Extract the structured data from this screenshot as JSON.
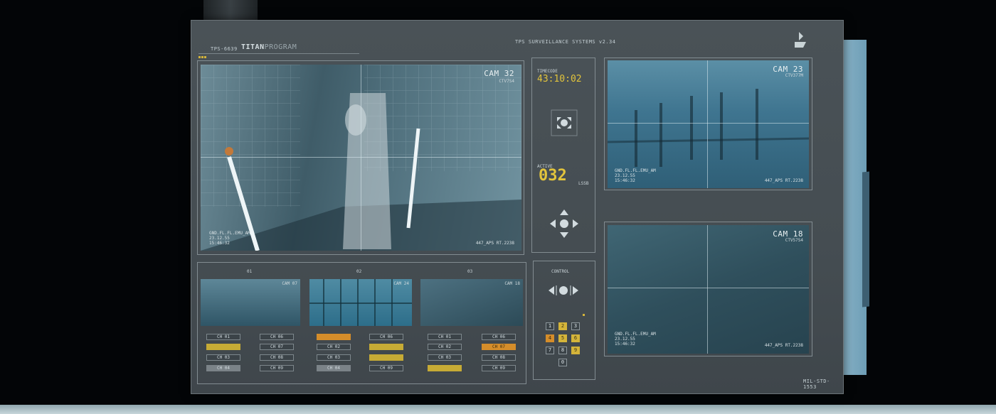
{
  "header": {
    "code": "TPS-6639",
    "title_bold": "TITAN",
    "title_light": "PROGRAM",
    "system": "TPS SURVEILLANCE SYSTEMS v2.34",
    "spec": "MIL-STD-1553"
  },
  "main_feed": {
    "cam": "CAM 32",
    "sub": "CTV7S4",
    "meta": [
      "GND.FL.FL.EMU_AM",
      "23.12.55",
      "15:46:32"
    ],
    "rate": "447_APS RT.2238"
  },
  "center": {
    "timecode_label": "TIMECODE",
    "timecode": "43:10:02",
    "active_label": "ACTIVE",
    "active_value": "032",
    "active_unit": "LSSB",
    "control_label": "CONTROL",
    "keys": [
      "1",
      "2",
      "3",
      "4",
      "5",
      "6",
      "7",
      "8",
      "9",
      "0"
    ]
  },
  "right_feeds": [
    {
      "cam": "CAM 23",
      "sub": "CTV377M",
      "meta": [
        "GND.FL.FL.EMU_AM",
        "23.12.55",
        "15:46:32"
      ],
      "rate": "447_APS RT.2238"
    },
    {
      "cam": "CAM 18",
      "sub": "CTV57S4",
      "meta": [
        "GND.FL.FL.EMU_AM",
        "23.12.55",
        "15:46:32"
      ],
      "rate": "447_APS RT.2238"
    }
  ],
  "bottom_groups": [
    {
      "num": "01",
      "cam": "CAM 07",
      "left": [
        "CH 01",
        "",
        "CH 03",
        "CH 04"
      ],
      "right": [
        "CH 06",
        "CH 07",
        "CH 08",
        "CH 09"
      ]
    },
    {
      "num": "02",
      "cam": "CAM 24",
      "left": [
        "",
        "CH 02",
        "CH 03",
        "CH 04"
      ],
      "right": [
        "CH 06",
        "",
        "",
        "CH 09"
      ]
    },
    {
      "num": "03",
      "cam": "CAM 18",
      "left": [
        "CH 01",
        "CH 02",
        "CH 03",
        ""
      ],
      "right": [
        "CH 06",
        "CH 07",
        "CH 08",
        "CH 09"
      ]
    }
  ]
}
